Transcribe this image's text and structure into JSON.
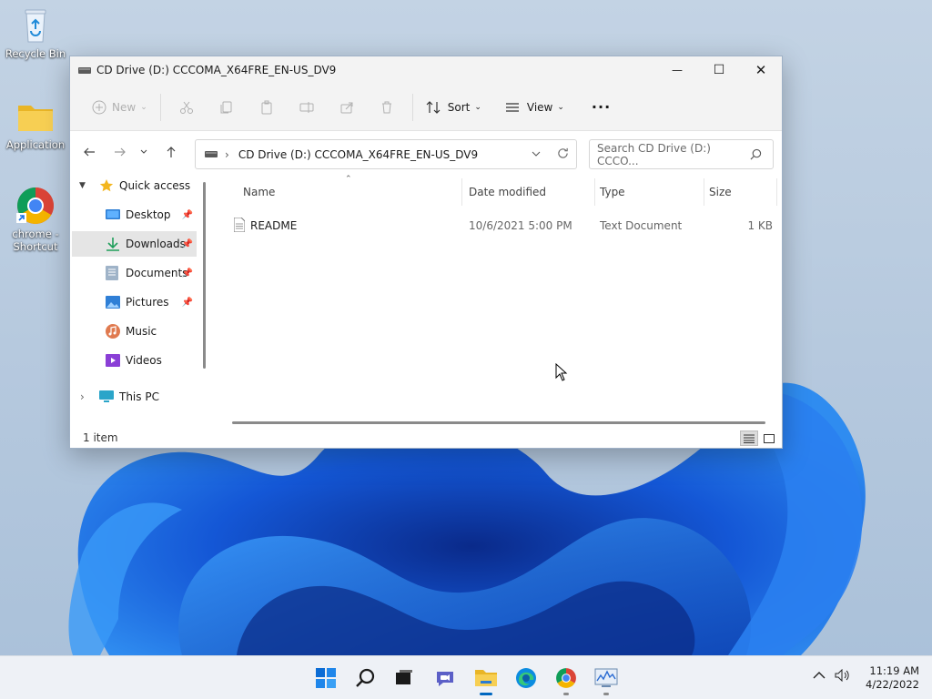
{
  "desktop": {
    "icons": [
      {
        "label": "Recycle Bin",
        "icon": "recycle-bin-icon"
      },
      {
        "label": "Application",
        "icon": "folder-icon"
      },
      {
        "label": "chrome - Shortcut",
        "icon": "chrome-icon"
      }
    ]
  },
  "window": {
    "title": "CD Drive (D:) CCCOMA_X64FRE_EN-US_DV9",
    "controls": {
      "minimize": "—",
      "maximize": "☐",
      "close": "✕"
    },
    "commands": {
      "new": "New",
      "sort": "Sort",
      "view": "View",
      "more": "···"
    },
    "address": "CD Drive (D:) CCCOMA_X64FRE_EN-US_DV9",
    "search_placeholder": "Search CD Drive (D:) CCCO...",
    "sidebar": {
      "quick_access": "Quick access",
      "items": [
        {
          "label": "Desktop",
          "pinned": true
        },
        {
          "label": "Downloads",
          "pinned": true,
          "selected": true
        },
        {
          "label": "Documents",
          "pinned": true
        },
        {
          "label": "Pictures",
          "pinned": true
        },
        {
          "label": "Music",
          "pinned": false
        },
        {
          "label": "Videos",
          "pinned": false
        }
      ],
      "this_pc": "This PC"
    },
    "columns": {
      "name": "Name",
      "date": "Date modified",
      "type": "Type",
      "size": "Size"
    },
    "files": [
      {
        "name": "README",
        "date": "10/6/2021 5:00 PM",
        "type": "Text Document",
        "size": "1 KB"
      }
    ],
    "status": "1 item"
  },
  "taskbar": {
    "time": "11:19 AM",
    "date": "4/22/2022"
  },
  "colors": {
    "accent": "#0067c0",
    "wallpaper_blue": "#1a5fd6",
    "folder_yellow": "#f4c542"
  }
}
